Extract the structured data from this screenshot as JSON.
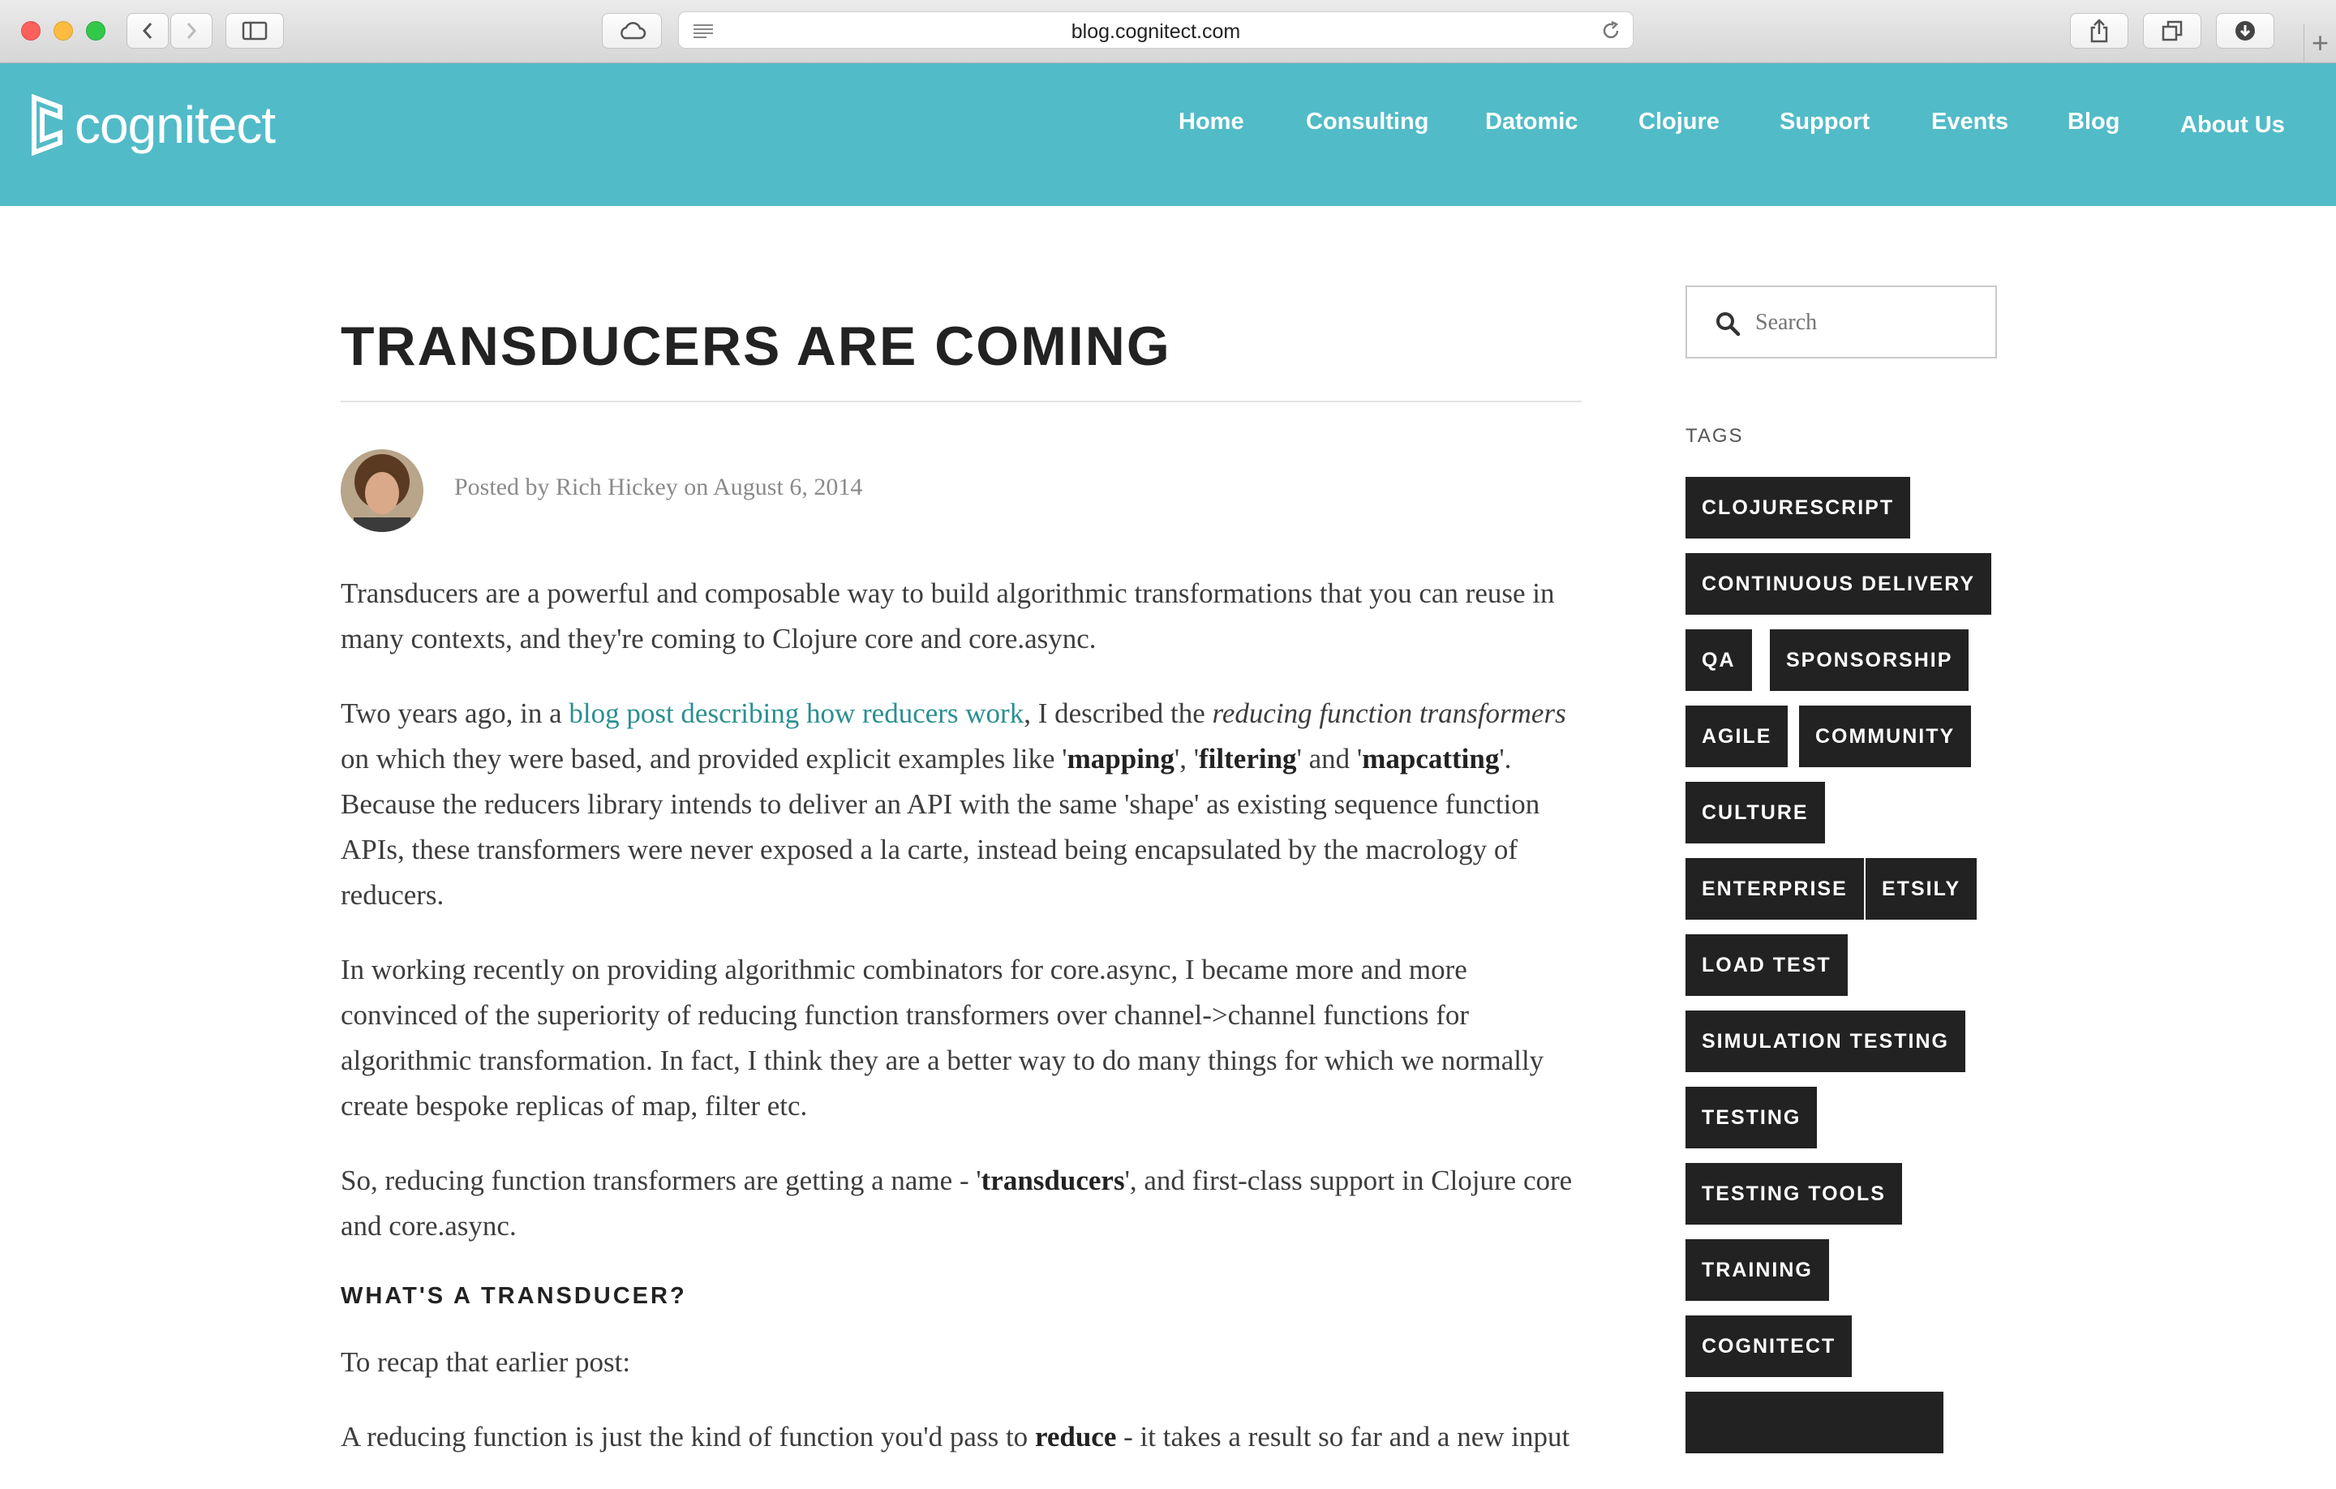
{
  "browser": {
    "url": "blog.cognitect.com"
  },
  "site": {
    "logo_text": "cognitect",
    "brand_color": "#52bbc8",
    "nav": [
      "Home",
      "Consulting",
      "Datomic",
      "Clojure",
      "Support",
      "Events",
      "Blog",
      "About Us"
    ]
  },
  "article": {
    "title": "TRANSDUCERS ARE COMING",
    "byline": "Posted by Rich Hickey on August 6, 2014",
    "p1": "Transducers are a powerful and composable way to build algorithmic transformations that you can reuse in many contexts, and they're coming to Clojure core and core.async.",
    "p2": {
      "a": "Two years ago, in a ",
      "link": "blog post describing how reducers work",
      "b": ", I described the ",
      "em": "reducing function transformers",
      "c": " on which they were based, and provided explicit examples like '",
      "s1": "mapping",
      "d": "', '",
      "s2": "filtering",
      "e": "' and '",
      "s3": "mapcatting",
      "f": "'. Because the reducers library intends to deliver an API with the same 'shape' as existing sequence function APIs, these transformers were never exposed a la carte, instead being encapsulated by the macrology of reducers."
    },
    "p3": "In working recently on providing algorithmic combinators for core.async, I became more and more convinced of the superiority of reducing function transformers over channel->channel functions for algorithmic transformation. In fact, I think they are a better way to do many things for which we normally create bespoke replicas of map, filter etc.",
    "p4": {
      "a": "So, reducing function transformers are getting a name - '",
      "s": "transducers",
      "b": "', and first-class support in Clojure core and core.async."
    },
    "h3": "WHAT'S A TRANSDUCER?",
    "p5": "To recap that earlier post:",
    "p6": {
      "a": "A reducing function is just the kind of function you'd pass to ",
      "s": "reduce",
      "b": " - it takes a result so far and a new input"
    }
  },
  "sidebar": {
    "search_placeholder": "Search",
    "tags_title": "TAGS",
    "tags": [
      "CLOJURESCRIPT",
      "CONTINUOUS DELIVERY",
      "QA",
      "SPONSORSHIP",
      "AGILE",
      "COMMUNITY",
      "CULTURE",
      "ENTERPRISE",
      "ETSILY",
      "LOAD TEST",
      "SIMULATION TESTING",
      "TESTING",
      "TESTING TOOLS",
      "TRAINING",
      "COGNITECT"
    ]
  }
}
